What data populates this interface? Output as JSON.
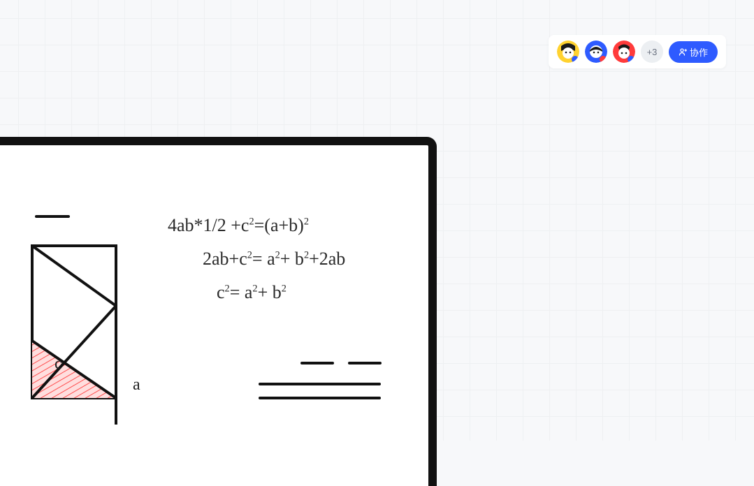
{
  "collab": {
    "overflow_count": "+3",
    "button_label": "协作",
    "avatars": [
      {
        "name": "user-1"
      },
      {
        "name": "user-2"
      },
      {
        "name": "user-3"
      }
    ]
  },
  "whiteboard": {
    "equations": {
      "line1_html": "4ab*1/2 +c<sup>2</sup>=(a+b)<sup>2</sup>",
      "line2_html": "2ab+c<sup>2</sup>= a<sup>2</sup>+ b<sup>2</sup>+2ab",
      "line3_html": "c<sup>2</sup>= a<sup>2</sup>+ b<sup>2</sup>"
    },
    "labels": {
      "c": "c",
      "a": "a"
    }
  }
}
